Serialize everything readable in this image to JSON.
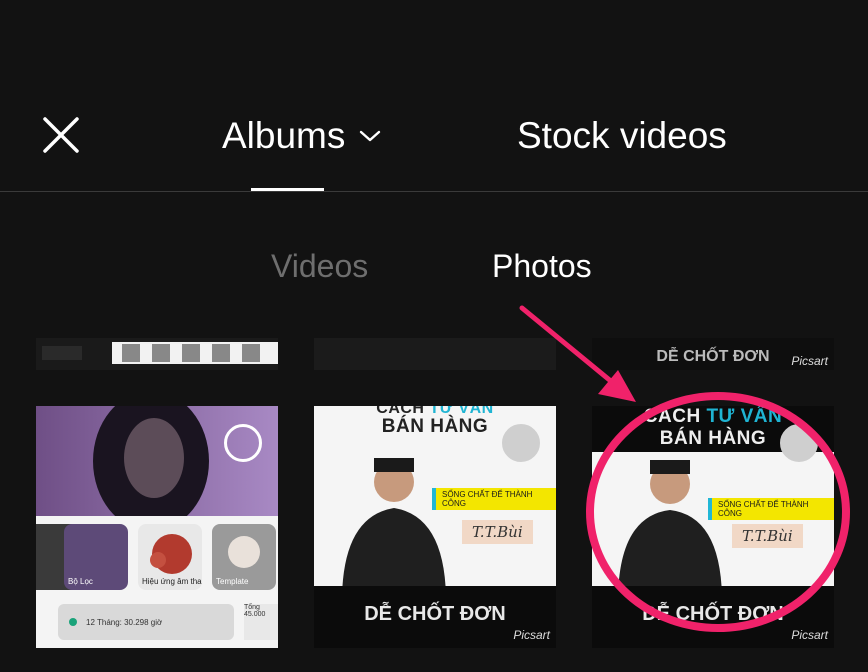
{
  "header": {
    "close_icon": "close-icon",
    "tabs": [
      {
        "label": "Albums",
        "active": true,
        "icon": "chevron-down-icon"
      },
      {
        "label": "Stock videos",
        "active": false
      }
    ]
  },
  "subtabs": [
    {
      "label": "Videos",
      "active": false
    },
    {
      "label": "Photos",
      "active": true
    }
  ],
  "thumbnails": {
    "top_row_partial": [
      {
        "caption": "Picsart",
        "partial_text": "DỄ CHỐT ĐƠN"
      }
    ],
    "video_title_prefix": "CÁCH",
    "video_title_highlight": "TƯ VẤN",
    "video_title_line2": "BÁN HÀNG",
    "video_cta": "DỄ CHỐT ĐƠN",
    "picsart": "Picsart",
    "badge_text": "SỐNG CHẤT ĐỂ THÀNH CÔNG",
    "signature": "T.T.Bùi",
    "photo_cards": [
      {
        "label": "Bộ Lọc"
      },
      {
        "label": "Hiệu ứng âm thanh"
      },
      {
        "label": "Template"
      }
    ],
    "stat_text": "12 Tháng: 30.298 giờ",
    "stat_side": "Tổng 45.000"
  },
  "annotation": {
    "arrow_color": "#f0226a",
    "circle_color": "#f0226a"
  },
  "colors": {
    "background": "#121212",
    "inactive_text": "#6e6e6e",
    "accent": "#f0226a"
  }
}
